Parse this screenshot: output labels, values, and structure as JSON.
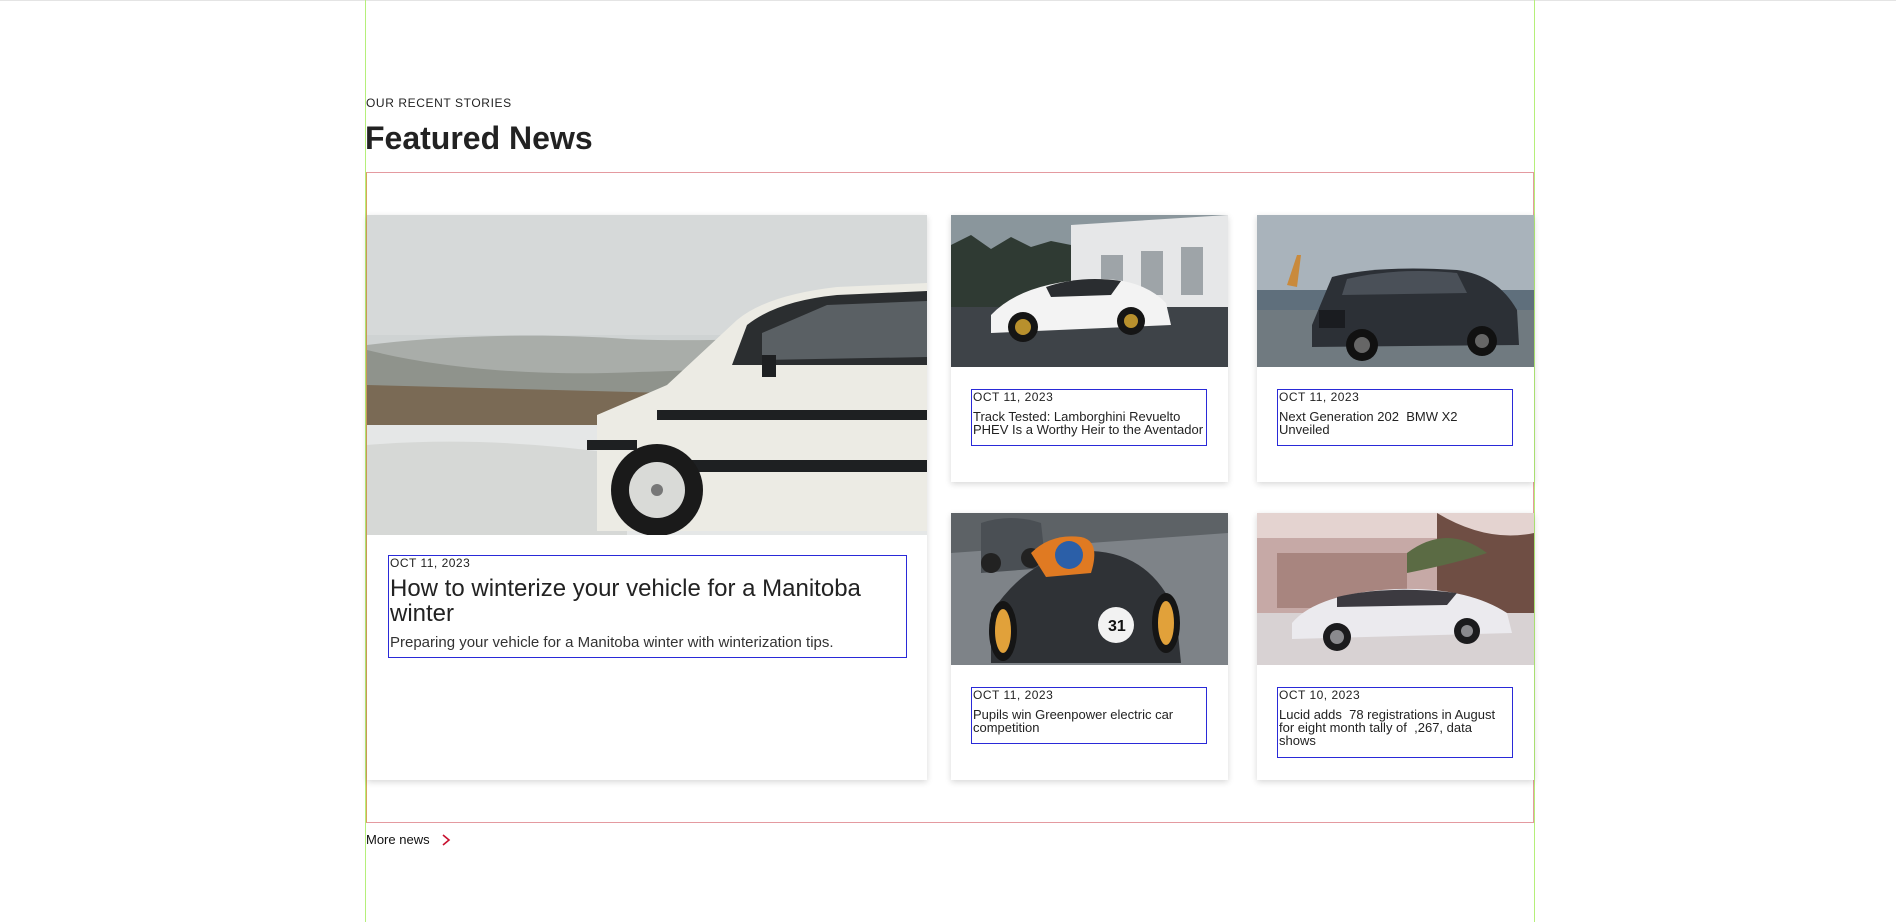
{
  "section": {
    "eyebrow": "OUR RECENT STORIES",
    "title": "Featured News"
  },
  "featured": {
    "date": "OCT 11, 2023",
    "title": "How to winterize your vehicle for a Manitoba winter",
    "excerpt": "Preparing your vehicle for a Manitoba winter with winterization tips."
  },
  "cards": [
    {
      "date": "OCT 11, 2023",
      "title": "Track Tested: Lamborghini Revuelto PHEV Is a Worthy Heir to the Aventador"
    },
    {
      "date": "OCT 11, 2023",
      "title": "Next Generation 202  BMW X2 Unveiled"
    },
    {
      "date": "OCT 11, 2023",
      "title": "Pupils win Greenpower electric car competition"
    },
    {
      "date": "OCT 10, 2023",
      "title": "Lucid adds  78 registrations in August for eight month tally of  ,267, data shows"
    }
  ],
  "footer": {
    "more_label": "More news"
  },
  "colors": {
    "accent": "#c8102e",
    "guide": "#b5ef7a",
    "outline": "#2a2ad8"
  },
  "icons": {
    "more": "chevron-right-icon"
  }
}
